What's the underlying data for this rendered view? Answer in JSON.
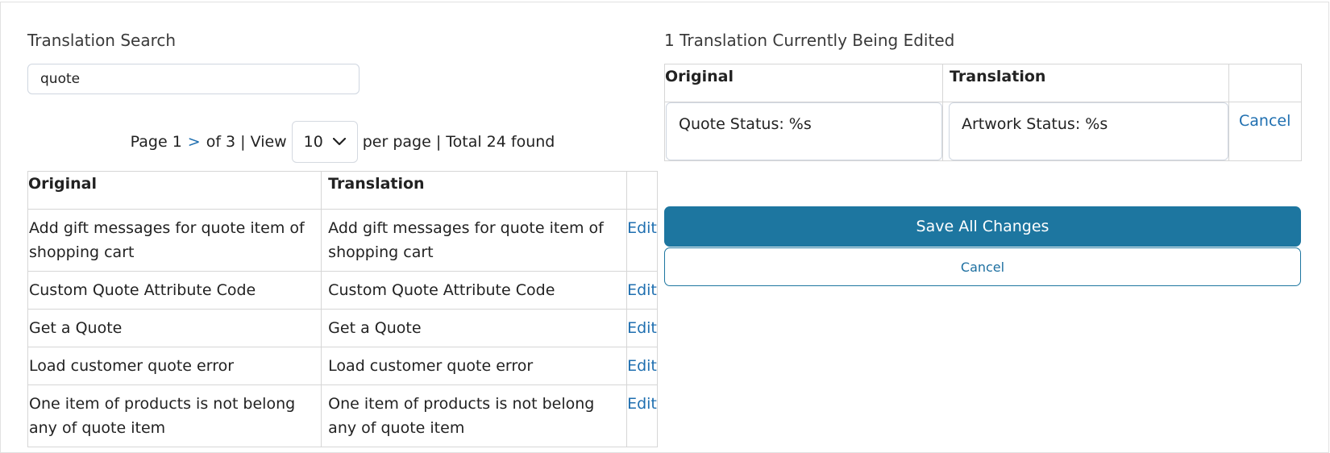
{
  "search": {
    "title": "Translation Search",
    "value": "quote"
  },
  "pager": {
    "page_label": "Page 1",
    "next_symbol": ">",
    "of_label": "of 3 | View",
    "per_page_value": "10",
    "suffix": "per page | Total 24 found"
  },
  "results": {
    "headers": {
      "original": "Original",
      "translation": "Translation"
    },
    "rows": [
      {
        "original": "Add gift messages for quote item of shopping cart",
        "translation": "Add gift messages for quote item of shopping cart",
        "action": "Edit"
      },
      {
        "original": "Custom Quote Attribute Code",
        "translation": "Custom Quote Attribute Code",
        "action": "Edit"
      },
      {
        "original": "Get a Quote",
        "translation": "Get a Quote",
        "action": "Edit"
      },
      {
        "original": "Load customer quote error",
        "translation": "Load customer quote error",
        "action": "Edit"
      },
      {
        "original": "One item of products is not belong any of quote item",
        "translation": "One item of products is not belong any of quote item",
        "action": "Edit"
      }
    ]
  },
  "editing": {
    "title": "1 Translation Currently Being Edited",
    "headers": {
      "original": "Original",
      "translation": "Translation"
    },
    "row": {
      "original": "Quote Status: %s",
      "translation": "Artwork Status: %s",
      "cancel": "Cancel"
    },
    "save_label": "Save All Changes",
    "cancel_label": "Cancel"
  },
  "colors": {
    "accent": "#1d76a0",
    "link": "#1f6fb0"
  }
}
